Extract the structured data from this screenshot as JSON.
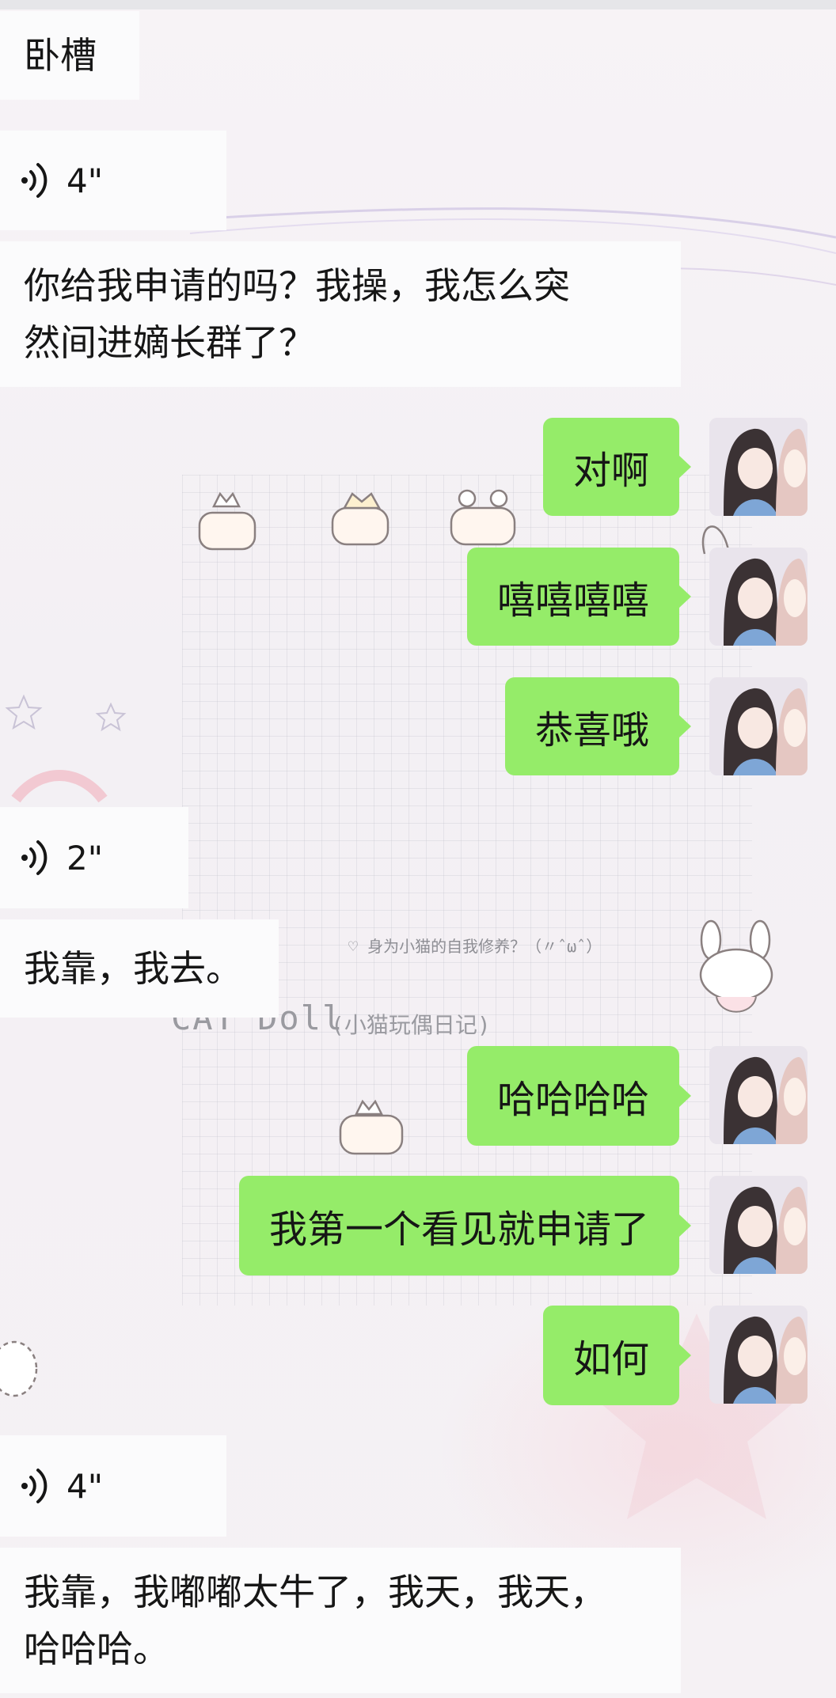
{
  "messages": {
    "m1": "卧槽",
    "m2_duration": "4\"",
    "m3": "你给我申请的吗？我操，我怎么突\n然间进嫡长群了？",
    "m4": "对啊",
    "m5": "嘻嘻嘻嘻",
    "m6": "恭喜哦",
    "m7_duration": "2\"",
    "m8": "我靠，我去。",
    "m9": "哈哈哈哈",
    "m10": "我第一个看见就申请了",
    "m11": "如何",
    "m12_duration": "4\"",
    "m13": "我靠，我嘟嘟太牛了，我天，我天，\n哈哈哈。"
  },
  "background_text": {
    "caption": "♡ 身为小猫的自我修养？（〃ˆωˆ）",
    "title": "CAT Doll",
    "subtitle": "(小猫玩偶日记)"
  },
  "colors": {
    "outgoing_bubble": "#95ec69",
    "incoming_bubble": "#fbfbfc",
    "text": "#161616"
  },
  "icons": {
    "voice": "voice-wave-icon",
    "avatar": "user-avatar"
  }
}
